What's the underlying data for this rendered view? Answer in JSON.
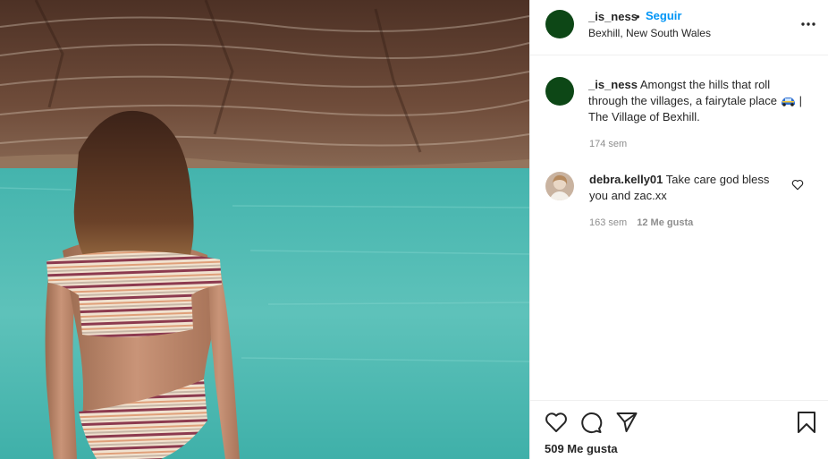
{
  "header": {
    "username": "_is_ness",
    "separator": "•",
    "follow_label": "Seguir",
    "location": "Bexhill, New South Wales",
    "more_icon": "more-horizontal-icon"
  },
  "caption": {
    "username": "_is_ness",
    "text_before": "Amongst the hills that roll through the villages, a fairytale place",
    "text_after": "| The Village of Bexhill.",
    "emoji_icon": "car-emoji-icon",
    "time": "174 sem"
  },
  "comments": [
    {
      "username": "debra.kelly01",
      "text": "Take care god bless you and zac.xx",
      "time": "163 sem",
      "likes": "12 Me gusta"
    }
  ],
  "actions": {
    "like_icon": "heart-icon",
    "comment_icon": "comment-icon",
    "share_icon": "share-icon",
    "save_icon": "bookmark-icon",
    "likes_count": "509 Me gusta"
  },
  "colors": {
    "link_blue": "#0095f6",
    "avatar_green": "#0d4716",
    "muted_text": "#8e8e8e",
    "water": "#4fbdb5",
    "rock": "#6e4a38"
  }
}
